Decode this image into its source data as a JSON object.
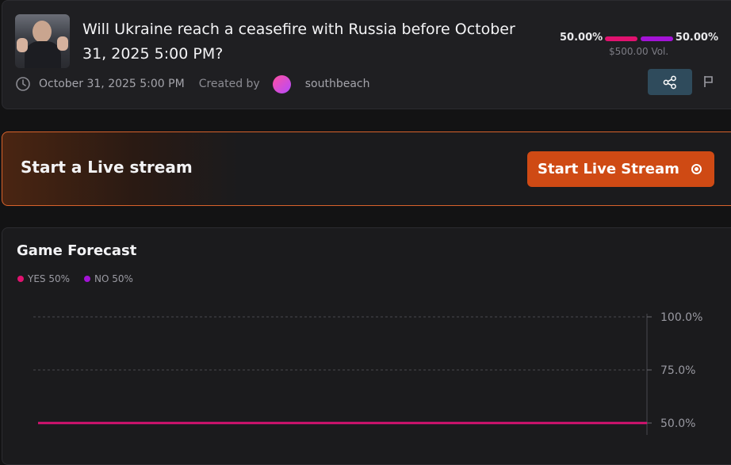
{
  "market": {
    "title": "Will Ukraine reach a ceasefire with Russia before October 31, 2025 5:00 PM?",
    "end_date": "October 31, 2025 5:00 PM",
    "created_by_label": "Created by",
    "creator": "southbeach",
    "thumbnail_icon": "market-photo"
  },
  "odds": {
    "yes_percent": "50.00%",
    "no_percent": "50.00%",
    "volume": "$500.00 Vol.",
    "yes_color": "#e0126f",
    "no_color": "#a313d6"
  },
  "actions": {
    "share_icon": "share-icon",
    "flag_icon": "flag-icon"
  },
  "live_stream": {
    "label": "Start a Live stream",
    "button_label": "Start Live Stream",
    "accent_color": "#cf4a14"
  },
  "forecast": {
    "title": "Game Forecast",
    "legend_yes": "YES 50%",
    "legend_no": "NO 50%"
  },
  "chart_data": {
    "type": "line",
    "title": "",
    "xlabel": "",
    "ylabel": "",
    "ylim": [
      0,
      100
    ],
    "y_ticks": [
      "100.0%",
      "75.0%",
      "50.0%"
    ],
    "y_tick_values": [
      100,
      75,
      50
    ],
    "series": [
      {
        "name": "YES",
        "color": "#e0126f",
        "values": [
          50,
          50
        ]
      },
      {
        "name": "NO",
        "color": "#a313d6",
        "values": [
          50,
          50
        ]
      }
    ],
    "grid": true,
    "legend": "top-left"
  }
}
